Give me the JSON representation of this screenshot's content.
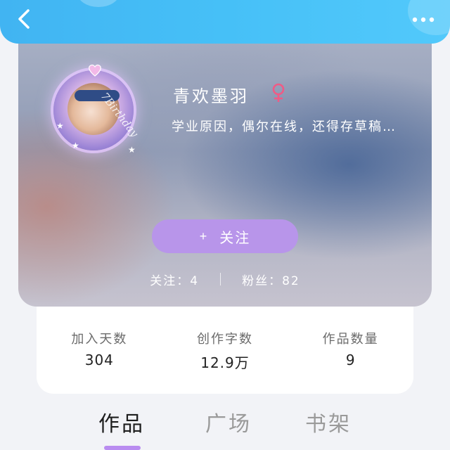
{
  "header": {
    "back_icon": "chevron-left-icon",
    "more_icon": "more-dots-icon"
  },
  "profile": {
    "name": "青欢墨羽",
    "gender_symbol": "♀",
    "gender_color": "#ef5b86",
    "bio": "学业原因，偶尔在线，还得存草稿…",
    "avatar_frame_text": "7Birthday",
    "follow_button": {
      "plus": "+",
      "label": "关注"
    },
    "following_label": "关注：4",
    "followers_label": "粉丝：82"
  },
  "stats": [
    {
      "label": "加入天数",
      "value": "304"
    },
    {
      "label": "创作字数",
      "value": "12.9万"
    },
    {
      "label": "作品数量",
      "value": "9"
    }
  ],
  "tabs": [
    "作品",
    "广场",
    "书架"
  ],
  "active_tab": "作品",
  "colors": {
    "header": "#46c0f7",
    "accent": "#b895ea",
    "tab_indicator": "#b98cf0"
  }
}
